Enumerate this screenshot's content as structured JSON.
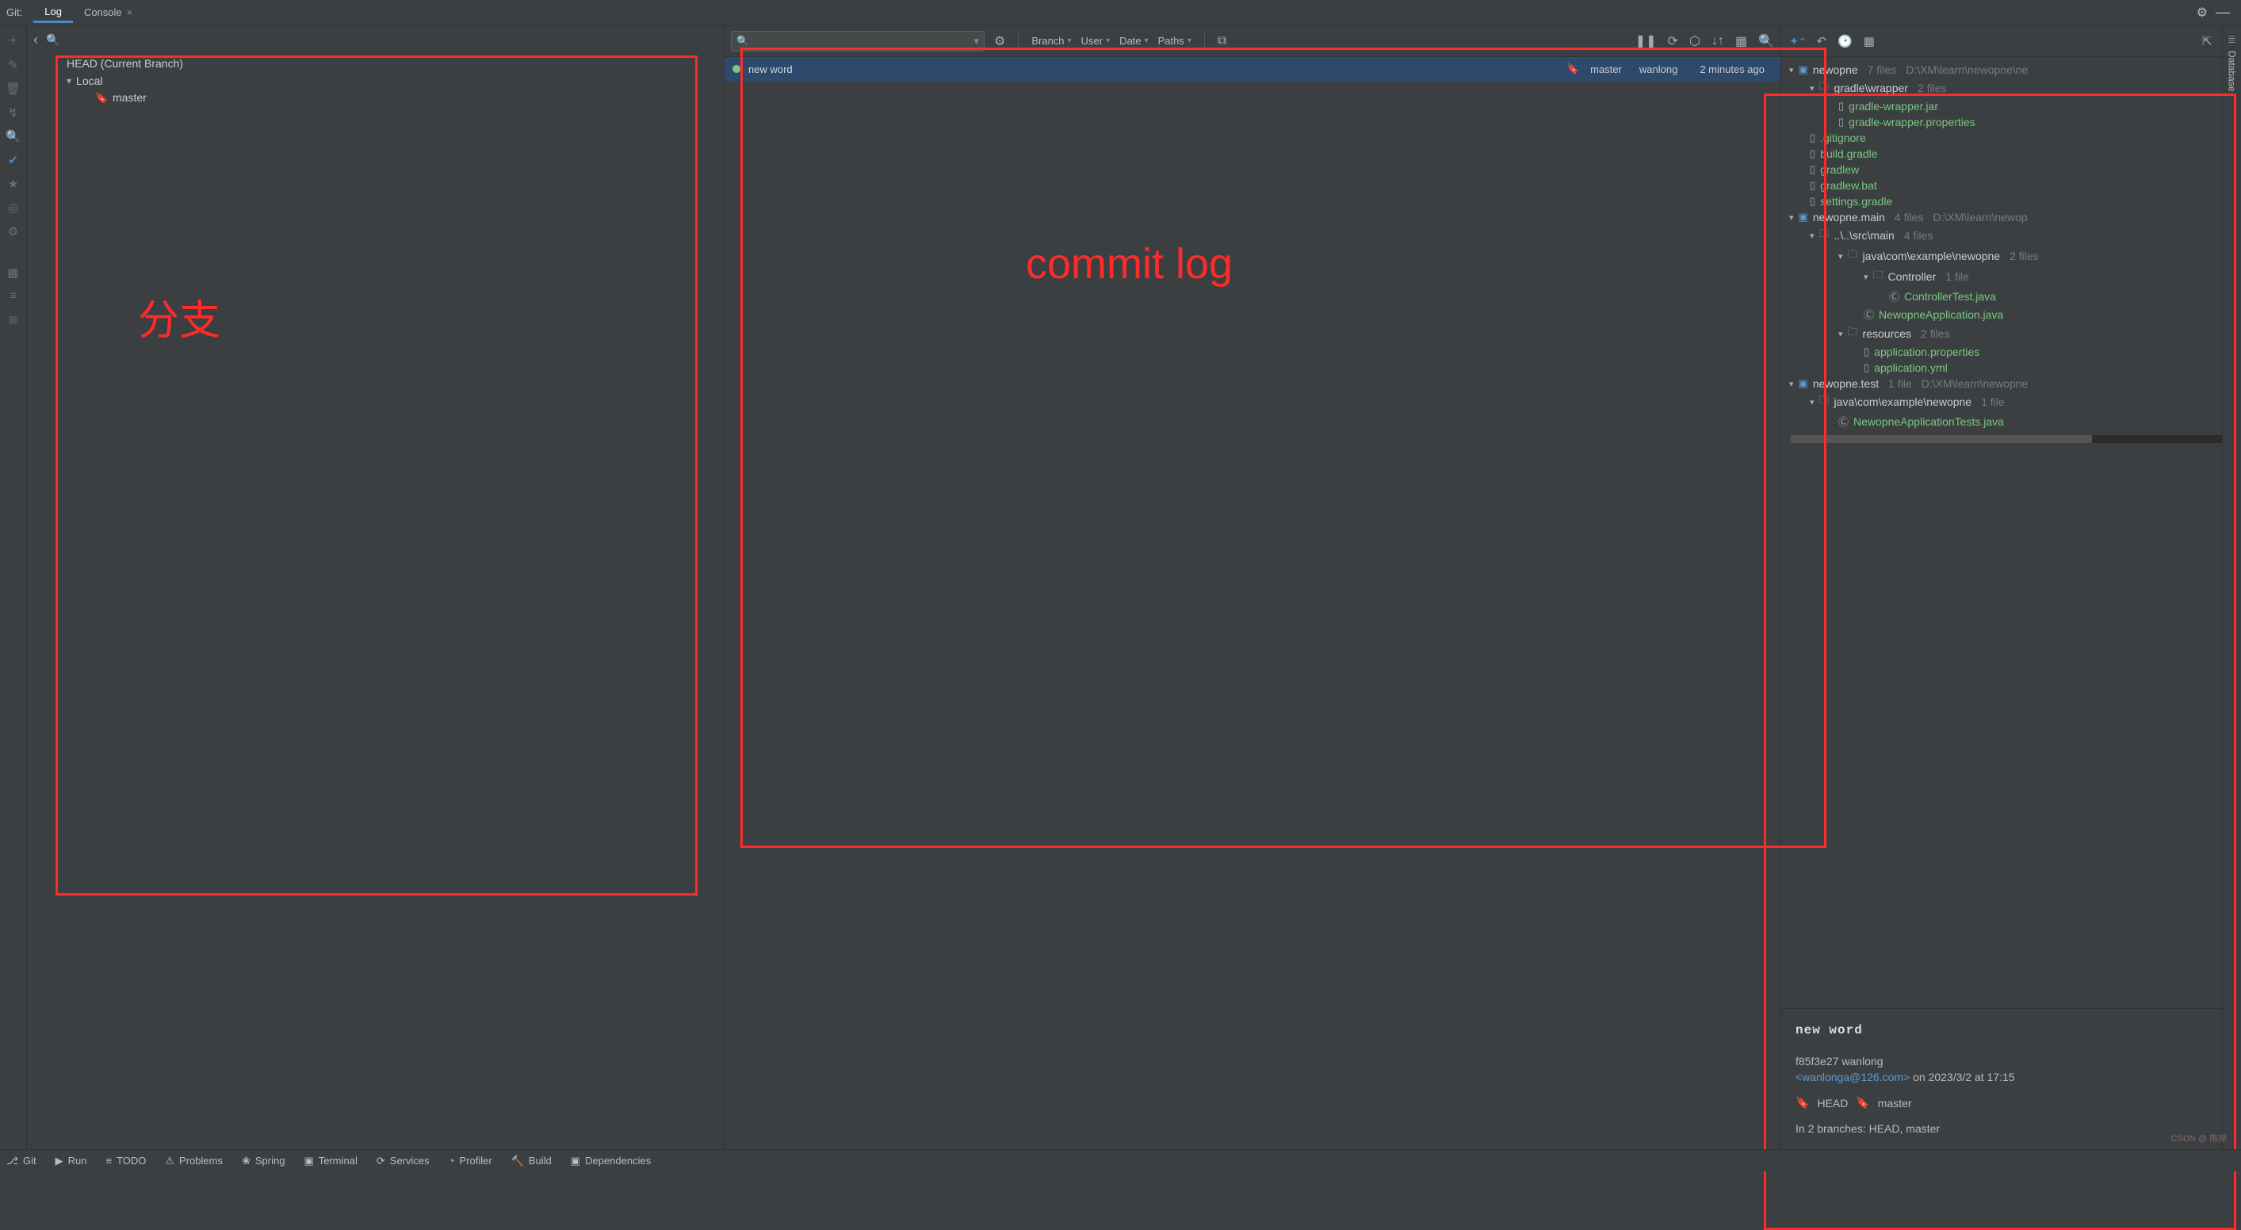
{
  "top": {
    "label": "Git:",
    "tabs": [
      {
        "label": "Log",
        "active": true
      },
      {
        "label": "Console",
        "active": false
      }
    ]
  },
  "branches": {
    "head": "HEAD (Current Branch)",
    "local_label": "Local",
    "items": [
      {
        "name": "master"
      }
    ]
  },
  "annotations": {
    "left": "分支",
    "middle": "commit   log"
  },
  "commits_toolbar": {
    "search_placeholder": "",
    "filters": {
      "branch": "Branch",
      "user": "User",
      "date": "Date",
      "paths": "Paths"
    }
  },
  "commits": [
    {
      "message": "new   word",
      "branch": "master",
      "author": "wanlong",
      "time": "2 minutes ago"
    }
  ],
  "right_tree": {
    "roots": [
      {
        "name": "newopne",
        "meta_files": "7 files",
        "path": "D:\\XM\\learn\\newopne\\ne",
        "children": [
          {
            "name": "gradle\\wrapper",
            "meta_files": "2 files",
            "files": [
              {
                "name": "gradle-wrapper.jar"
              },
              {
                "name": "gradle-wrapper.properties"
              }
            ]
          }
        ],
        "files": [
          {
            "name": ".gitignore"
          },
          {
            "name": "build.gradle"
          },
          {
            "name": "gradlew"
          },
          {
            "name": "gradlew.bat"
          },
          {
            "name": "settings.gradle"
          }
        ]
      },
      {
        "name": "newopne.main",
        "meta_files": "4 files",
        "path": "D:\\XM\\learn\\newop",
        "children": [
          {
            "name": "..\\..\\src\\main",
            "meta_files": "4 files",
            "children": [
              {
                "name": "java\\com\\example\\newopne",
                "meta_files": "2 files",
                "children": [
                  {
                    "name": "Controller",
                    "meta_files": "1 file",
                    "files": [
                      {
                        "name": "ControllerTest.java"
                      }
                    ]
                  }
                ],
                "files": [
                  {
                    "name": "NewopneApplication.java"
                  }
                ]
              },
              {
                "name": "resources",
                "meta_files": "2 files",
                "files": [
                  {
                    "name": "application.properties"
                  },
                  {
                    "name": "application.yml"
                  }
                ]
              }
            ]
          }
        ]
      },
      {
        "name": "newopne.test",
        "meta_files": "1 file",
        "path": "D:\\XM\\learn\\newopne",
        "children": [
          {
            "name": "java\\com\\example\\newopne",
            "meta_files": "1 file",
            "files": [
              {
                "name": "NewopneApplicationTests.java"
              }
            ]
          }
        ]
      }
    ]
  },
  "commit_detail": {
    "title": "new   word",
    "hash": "f85f3e27",
    "author": "wanlong",
    "email": "<wanlonga@126.com>",
    "date_prefix": "on",
    "date": "2023/3/2 at 17:15",
    "tag_head": "HEAD",
    "tag_master": "master",
    "branches_line": "In 2 branches: HEAD, master"
  },
  "right_edge": {
    "label1": "Database"
  },
  "status": {
    "items": [
      {
        "label": "Git"
      },
      {
        "label": "Run"
      },
      {
        "label": "TODO"
      },
      {
        "label": "Problems"
      },
      {
        "label": "Spring"
      },
      {
        "label": "Terminal"
      },
      {
        "label": "Services"
      },
      {
        "label": "Profiler"
      },
      {
        "label": "Build"
      },
      {
        "label": "Dependencies"
      }
    ]
  },
  "watermark": "CSDN @ 南岸"
}
